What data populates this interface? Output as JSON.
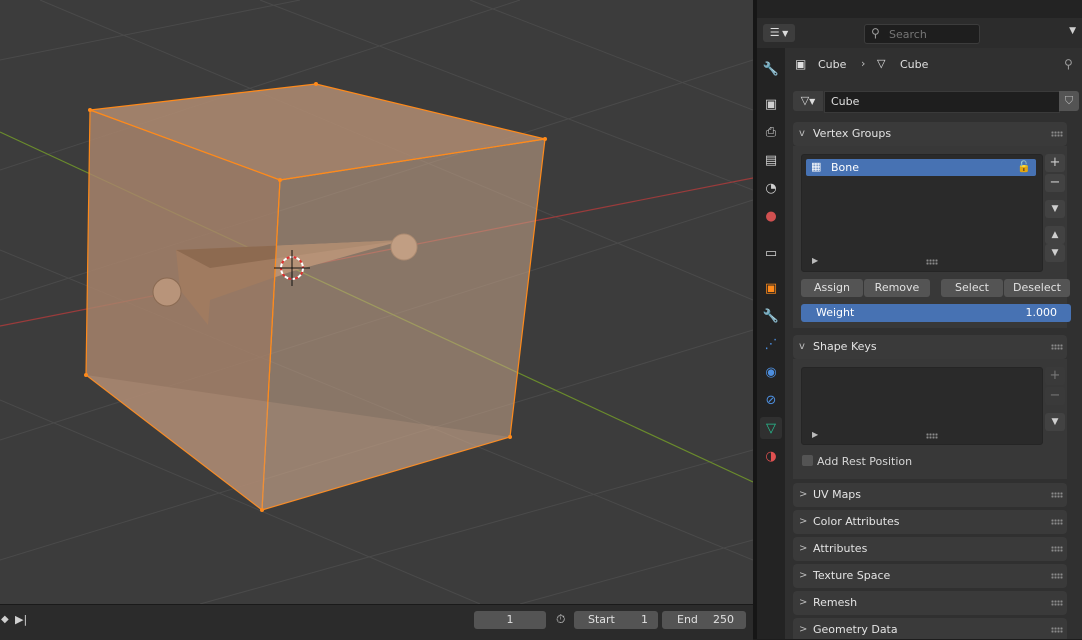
{
  "header": {
    "search_placeholder": "Search",
    "breadcrumb_object": "Cube",
    "breadcrumb_mesh": "Cube",
    "datablock_name": "Cube"
  },
  "vertex_groups": {
    "title": "Vertex Groups",
    "items": [
      {
        "name": "Bone"
      }
    ],
    "buttons": {
      "assign": "Assign",
      "remove": "Remove",
      "select": "Select",
      "deselect": "Deselect"
    },
    "weight_label": "Weight",
    "weight_value": "1.000"
  },
  "shape_keys": {
    "title": "Shape Keys",
    "add_rest_position": "Add Rest Position",
    "add_rest_position_checked": false
  },
  "collapsed_panels": [
    {
      "title": "UV Maps"
    },
    {
      "title": "Color Attributes"
    },
    {
      "title": "Attributes"
    },
    {
      "title": "Texture Space"
    },
    {
      "title": "Remesh"
    },
    {
      "title": "Geometry Data"
    }
  ],
  "timeline": {
    "current_frame": "1",
    "start_label": "Start",
    "start_value": "1",
    "end_label": "End",
    "end_value": "250"
  },
  "tabs": [
    {
      "icon": "tool-icon"
    },
    {
      "icon": "render-icon"
    },
    {
      "icon": "output-icon"
    },
    {
      "icon": "view-layer-icon"
    },
    {
      "icon": "scene-icon"
    },
    {
      "icon": "world-icon"
    },
    {
      "icon": "collection-icon"
    },
    {
      "icon": "object-icon"
    },
    {
      "icon": "modifier-icon"
    },
    {
      "icon": "particles-icon"
    },
    {
      "icon": "physics-icon"
    },
    {
      "icon": "constraints-icon"
    },
    {
      "icon": "mesh-data-icon",
      "active": true
    },
    {
      "icon": "material-icon"
    }
  ],
  "colors": {
    "accent": "#4772b3",
    "selection_orange": "#ff8a1a",
    "mesh_data_green": "#27c394"
  }
}
